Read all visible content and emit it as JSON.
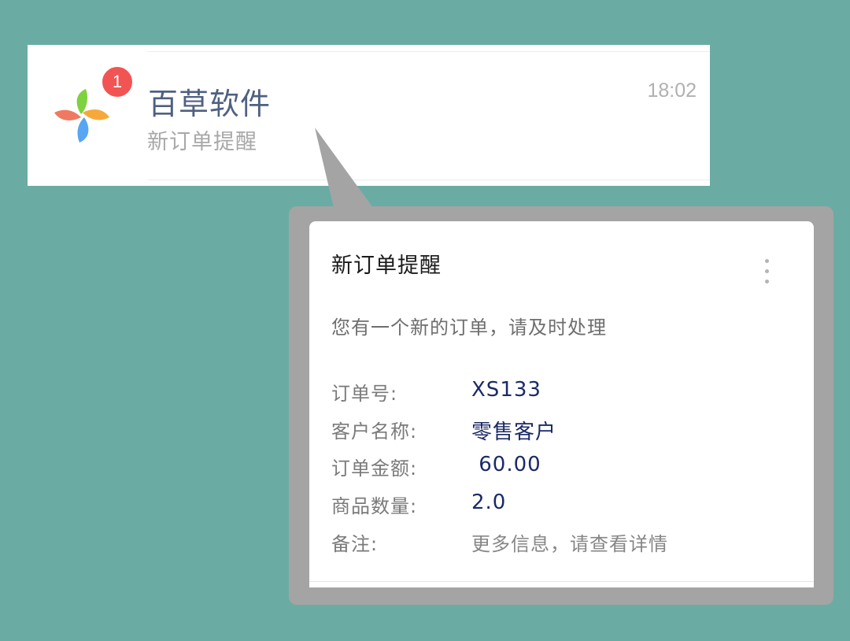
{
  "chat": {
    "name": "百草软件",
    "preview": "新订单提醒",
    "time": "18:02",
    "unread_count": "1"
  },
  "logo": {
    "icon": "pinwheel-logo-icon",
    "colors": [
      "#7ed13f",
      "#f6a93b",
      "#58a6f2",
      "#ef7a62"
    ]
  },
  "card": {
    "title": "新订单提醒",
    "message": "您有一个新的订单，请及时处理",
    "fields": [
      {
        "label": "订单号:",
        "value": "XS133"
      },
      {
        "label": "客户名称:",
        "value": "零售客户"
      },
      {
        "label": "订单金额:",
        "value": " 60.00"
      },
      {
        "label": "商品数量:",
        "value": "2.0"
      },
      {
        "label": "备注:",
        "value": "更多信息，请查看详情"
      }
    ]
  },
  "colors": {
    "background": "#6aaca3",
    "badge": "#f25454",
    "value_text": "#1b2a66"
  }
}
